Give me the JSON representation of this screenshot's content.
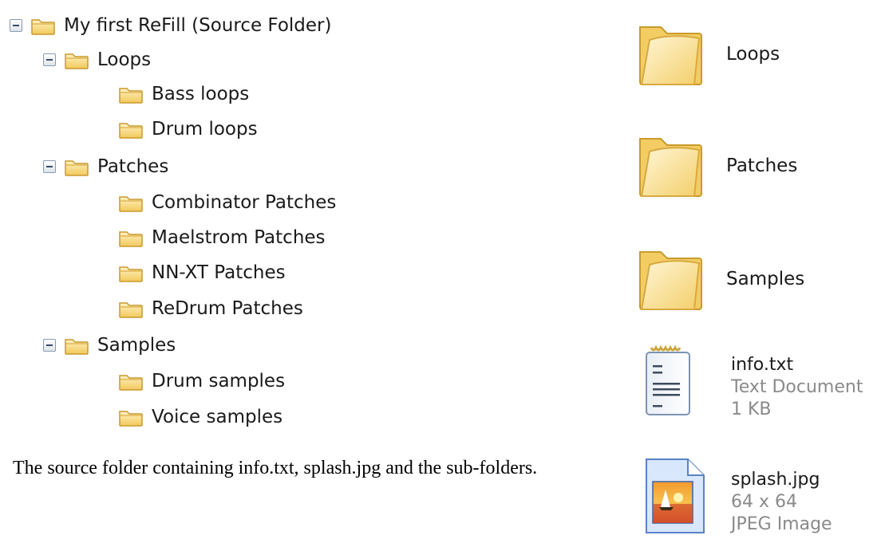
{
  "tree": {
    "root": "My first ReFill (Source Folder)",
    "loops": "Loops",
    "loops_children": [
      "Bass loops",
      "Drum loops"
    ],
    "patches": "Patches",
    "patches_children": [
      "Combinator Patches",
      "Maelstrom Patches",
      "NN-XT Patches",
      "ReDrum Patches"
    ],
    "samples": "Samples",
    "samples_children": [
      "Drum samples",
      "Voice samples"
    ]
  },
  "caption": "The source folder containing info.txt, splash.jpg and the sub-folders.",
  "files": {
    "folder_loops": "Loops",
    "folder_patches": "Patches",
    "folder_samples": "Samples",
    "info": {
      "name": "info.txt",
      "type": "Text Document",
      "size": "1 KB"
    },
    "splash": {
      "name": "splash.jpg",
      "dims": "64 x 64",
      "type": "JPEG Image"
    }
  },
  "icons": {
    "tree_toggle": "collapse-minus-icon",
    "small_folder": "folder-icon",
    "large_folder": "large-folder-icon",
    "text_file": "text-document-icon",
    "image_file": "jpeg-image-icon"
  },
  "colors": {
    "folder_fill": "#f7d97a",
    "folder_edge": "#c99a2e",
    "text": "#1a1a1a",
    "muted": "#8a8a8a"
  }
}
